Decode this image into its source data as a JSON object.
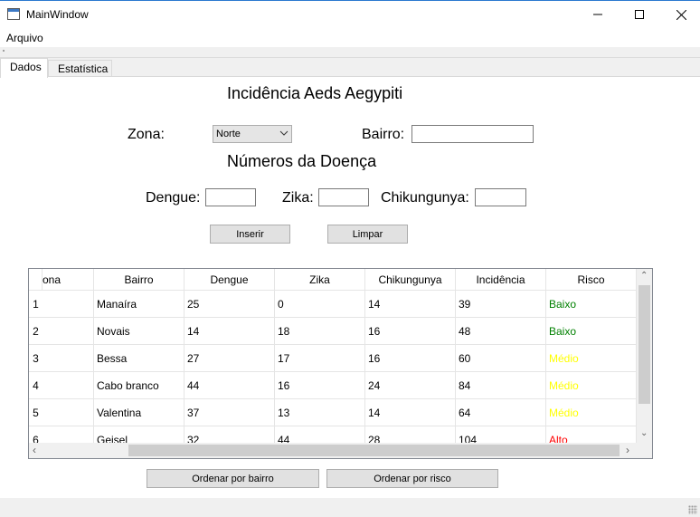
{
  "window": {
    "title": "MainWindow"
  },
  "menu": {
    "arquivo": "Arquivo"
  },
  "tabs": [
    {
      "label": "Dados",
      "active": true
    },
    {
      "label": "Estatística",
      "active": false
    }
  ],
  "form": {
    "title": "Incidência Aeds Aegypiti",
    "zona_label": "Zona:",
    "zona_value": "Norte",
    "bairro_label": "Bairro:",
    "bairro_value": "",
    "subtitle": "Números da Doença",
    "dengue_label": "Dengue:",
    "dengue_value": "",
    "zika_label": "Zika:",
    "zika_value": "",
    "chik_label": "Chikungunya:",
    "chik_value": "",
    "inserir": "Inserir",
    "limpar": "Limpar"
  },
  "table": {
    "columns": [
      "ona",
      "Bairro",
      "Dengue",
      "Zika",
      "Chikungunya",
      "Incidência",
      "Risco"
    ],
    "rows": [
      {
        "num": "1",
        "zona": "",
        "bairro": "Manaíra",
        "dengue": "25",
        "zika": "0",
        "chik": "14",
        "incidencia": "39",
        "risco": "Baixo"
      },
      {
        "num": "2",
        "zona": "",
        "bairro": "Novais",
        "dengue": "14",
        "zika": "18",
        "chik": "16",
        "incidencia": "48",
        "risco": "Baixo"
      },
      {
        "num": "3",
        "zona": "",
        "bairro": "Bessa",
        "dengue": "27",
        "zika": "17",
        "chik": "16",
        "incidencia": "60",
        "risco": "Médio"
      },
      {
        "num": "4",
        "zona": "",
        "bairro": "Cabo branco",
        "dengue": "44",
        "zika": "16",
        "chik": "24",
        "incidencia": "84",
        "risco": "Médio"
      },
      {
        "num": "5",
        "zona": "",
        "bairro": "Valentina",
        "dengue": "37",
        "zika": "13",
        "chik": "14",
        "incidencia": "64",
        "risco": "Médio"
      },
      {
        "num": "6",
        "zona": "",
        "bairro": "Geisel",
        "dengue": "32",
        "zika": "44",
        "chik": "28",
        "incidencia": "104",
        "risco": "Alto"
      }
    ]
  },
  "risk_colors": {
    "Baixo": "#008000",
    "Médio": "#ffff00",
    "Alto": "#ff0000"
  },
  "buttons": {
    "ordenar_bairro": "Ordenar por bairro",
    "ordenar_risco": "Ordenar por risco"
  },
  "icons": {
    "app": "window-app-icon",
    "min": "minimize-icon",
    "max": "maximize-icon",
    "close": "close-icon"
  }
}
